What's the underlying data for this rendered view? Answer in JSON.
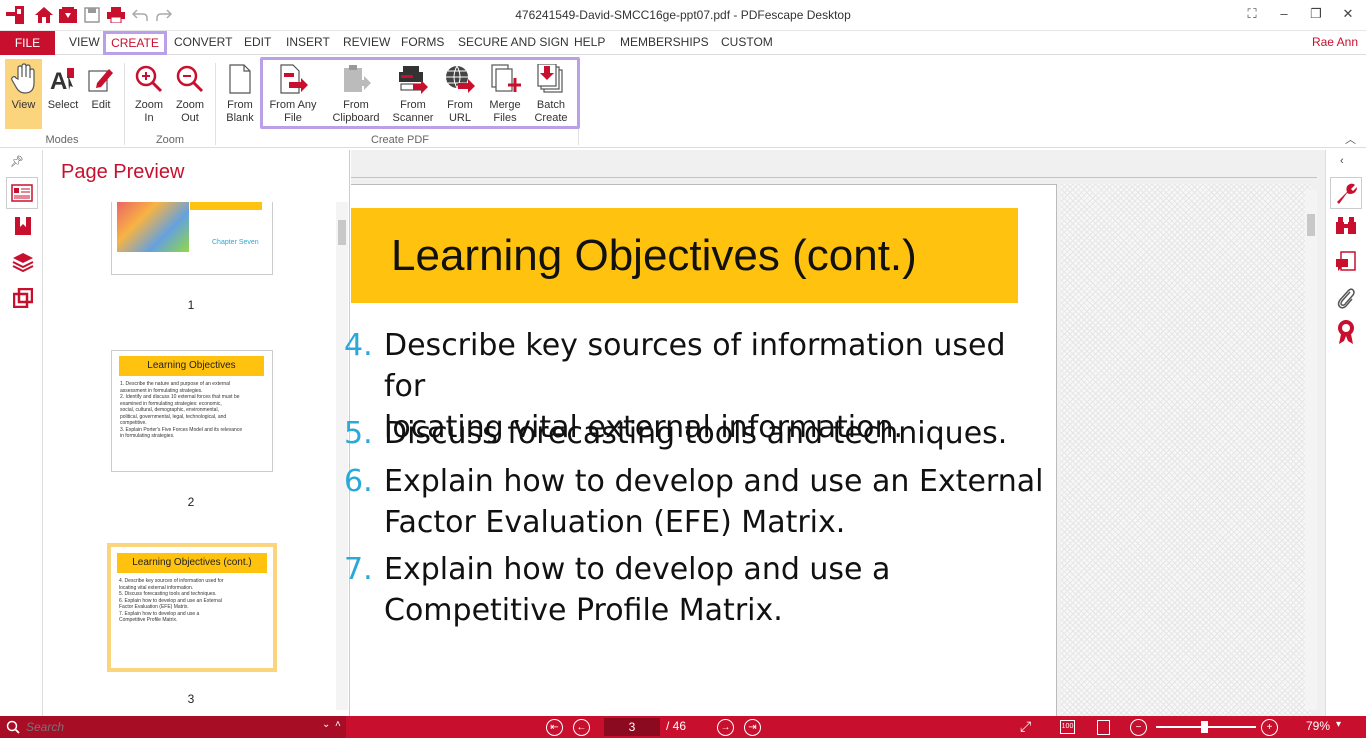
{
  "window": {
    "title": "476241549-David-SMCC16ge-ppt07.pdf   -   PDFescape Desktop",
    "user": "Rae Ann"
  },
  "quick_access": [
    "app-logo-icon",
    "home-icon",
    "save-down-icon",
    "save-icon",
    "print-icon",
    "undo-icon",
    "redo-icon"
  ],
  "menu": {
    "file": "FILE",
    "items": [
      "VIEW",
      "CREATE",
      "CONVERT",
      "EDIT",
      "INSERT",
      "REVIEW",
      "FORMS",
      "SECURE AND SIGN",
      "HELP",
      "MEMBERSHIPS",
      "CUSTOM"
    ]
  },
  "ribbon": {
    "modes": {
      "label": "Modes",
      "view": "View",
      "select": "Select",
      "edit": "Edit"
    },
    "zoom": {
      "label": "Zoom",
      "zoom_in_1": "Zoom",
      "zoom_in_2": "In",
      "zoom_out_1": "Zoom",
      "zoom_out_2": "Out"
    },
    "create": {
      "label": "Create PDF",
      "from_blank_1": "From",
      "from_blank_2": "Blank",
      "from_any_1": "From Any",
      "from_any_2": "File",
      "from_clip_1": "From",
      "from_clip_2": "Clipboard",
      "from_scanner_1": "From",
      "from_scanner_2": "Scanner",
      "from_url_1": "From",
      "from_url_2": "URL",
      "merge_1": "Merge",
      "merge_2": "Files",
      "batch_1": "Batch",
      "batch_2": "Create"
    }
  },
  "preview": {
    "title": "Page Preview",
    "pages": [
      {
        "num": "1",
        "subtitle": "Chapter Seven"
      },
      {
        "num": "2",
        "title": "Learning Objectives",
        "lines": [
          "1.  Describe the nature and purpose of an external",
          "     assessment in formulating strategies.",
          "2.  Identify and discuss 10 external forces that must be",
          "     examined in formulating strategies: economic,",
          "     social, cultural, demographic, environmental,",
          "     political, governmental, legal, technological, and",
          "     competitive.",
          "3.  Explain Porter's Five Forces Model and its relevance",
          "     in formulating strategies."
        ]
      },
      {
        "num": "3",
        "title": "Learning Objectives (cont.)",
        "lines": [
          "4.  Describe key sources of information used for",
          "     locating vital external information.",
          "5.  Discuss forecasting tools and techniques.",
          "6.  Explain how to develop and use an External",
          "     Factor Evaluation (EFE) Matrix.",
          "7.  Explain how to develop and use a",
          "     Competitive Profile Matrix."
        ]
      }
    ]
  },
  "document": {
    "title": "Learning Objectives (cont.)",
    "objectives": [
      {
        "num": "4.",
        "line1": "Describe key sources of information used for",
        "line2": "locating vital external information."
      },
      {
        "num": "5.",
        "line1": "Discuss forecasting tools and techniques.",
        "line2": ""
      },
      {
        "num": "6.",
        "line1": "Explain how to develop and use an External",
        "line2": "Factor Evaluation (EFE) Matrix."
      },
      {
        "num": "7.",
        "line1": "Explain how to develop and use a",
        "line2": "Competitive Profile Matrix."
      }
    ]
  },
  "status": {
    "search_placeholder": "Search",
    "current_page": "3",
    "total_pages": "/ 46",
    "zoom_level": "79%",
    "zoom_fraction": 0.48
  },
  "colors": {
    "accent": "#c8102e",
    "highlight": "#b9a0e8",
    "slide_yellow": "#ffc20e"
  }
}
